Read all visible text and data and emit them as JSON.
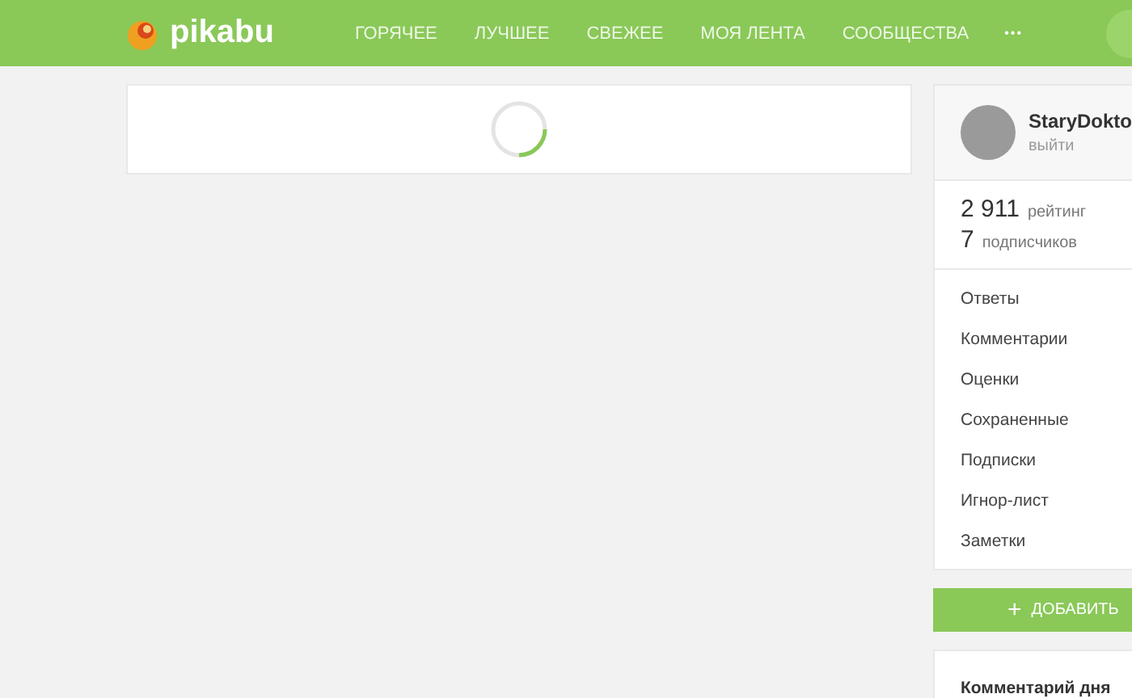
{
  "header": {
    "logo": "pikabu",
    "nav": [
      {
        "label": "ГОРЯЧЕЕ"
      },
      {
        "label": "ЛУЧШЕЕ"
      },
      {
        "label": "СВЕЖЕЕ"
      },
      {
        "label": "МОЯ ЛЕНТА"
      },
      {
        "label": "СООБЩЕСТВА"
      }
    ],
    "more": "•••"
  },
  "profile": {
    "username": "StaryDokto",
    "logout": "выйти",
    "rating_value": "2 911",
    "rating_label": "рейтинг",
    "subscribers_value": "7",
    "subscribers_label": "подписчиков"
  },
  "menu": [
    {
      "label": "Ответы"
    },
    {
      "label": "Комментарии"
    },
    {
      "label": "Оценки"
    },
    {
      "label": "Сохраненные"
    },
    {
      "label": "Подписки"
    },
    {
      "label": "Игнор-лист"
    },
    {
      "label": "Заметки"
    }
  ],
  "add_button": {
    "icon": "+",
    "label": "ДОБАВИТЬ"
  },
  "comment_of_day": {
    "title": "Комментарий дня"
  }
}
